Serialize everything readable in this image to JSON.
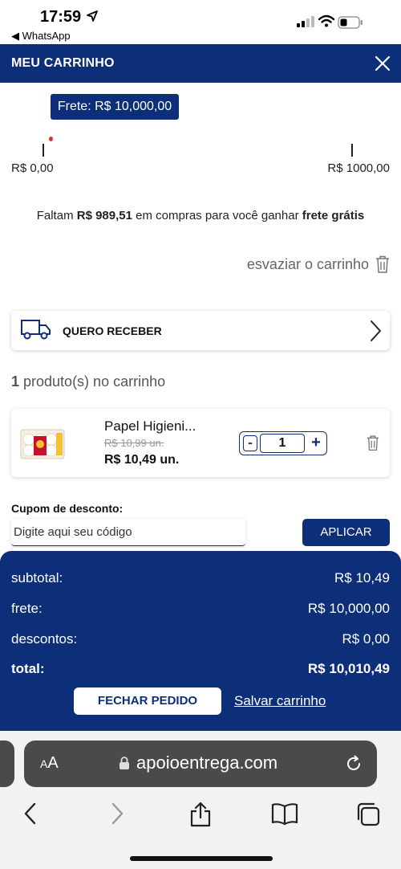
{
  "status_bar": {
    "time": "17:59",
    "back_app": "◀ WhatsApp"
  },
  "header": {
    "title": "MEU CARRINHO"
  },
  "freight": {
    "badge": "Frete: R$ 10,000,00",
    "min_label": "R$ 0,00",
    "max_label": "R$ 1000,00",
    "progress_fraction": 0.01,
    "message_prefix": "Faltam ",
    "message_amount": "R$ 989,51",
    "message_middle": " em compras para você ganhar ",
    "message_bold": "frete grátis"
  },
  "empty_cart": {
    "label": "esvaziar o carrinho"
  },
  "delivery": {
    "label": "QUERO RECEBER"
  },
  "products_count": {
    "count": "1",
    "label": " produto(s) no carrinho"
  },
  "product": {
    "name": "Papel Higieni...",
    "old_price": "R$ 10,99 un.",
    "price": "R$ 10,49 un.",
    "qty_minus": "-",
    "quantity": "1",
    "qty_plus": "+"
  },
  "coupon": {
    "label": "Cupom de desconto:",
    "placeholder": "Digite aqui seu código",
    "button": "APLICAR"
  },
  "totals": {
    "subtotal_label": "subtotal:",
    "subtotal_value": "R$ 10,49",
    "frete_label": "frete:",
    "frete_value": "R$ 10,000,00",
    "descontos_label": "descontos:",
    "descontos_value": "R$ 0,00",
    "total_label": "total:",
    "total_value": "R$ 10,010,49",
    "close_order": "FECHAR PEDIDO",
    "save_cart": "Salvar carrinho"
  },
  "browser": {
    "aa_small": "A",
    "aa_large": "A",
    "url": "apoioentrega.com"
  },
  "colors": {
    "brand": "#0d2f7a",
    "progress_marker": "#e0302e"
  },
  "icons": [
    "location-arrow-icon",
    "signal-icon",
    "wifi-icon",
    "battery-icon",
    "close-icon",
    "trash-icon",
    "truck-icon",
    "chevron-right-icon",
    "lock-icon",
    "reload-icon",
    "back-icon",
    "forward-icon",
    "share-icon",
    "bookmarks-icon",
    "tabs-icon"
  ]
}
